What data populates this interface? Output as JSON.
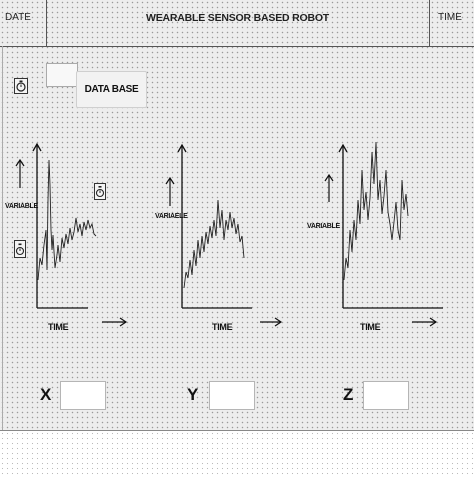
{
  "header": {
    "date_label": "DATE",
    "title": "WEARABLE SENSOR BASED ROBOT",
    "time_label": "TIME"
  },
  "toolbar": {
    "database_label": "DATA BASE"
  },
  "plots": [
    {
      "id": "x",
      "ylabel": "VARIABLE",
      "xlabel": "TIME"
    },
    {
      "id": "y",
      "ylabel": "VARIAELE",
      "xlabel": "TIME"
    },
    {
      "id": "z",
      "ylabel": "VARIABLE",
      "xlabel": "TIME"
    }
  ],
  "readouts": {
    "x_label": "X",
    "y_label": "Y",
    "z_label": "Z",
    "x_value": "",
    "y_value": "",
    "z_value": ""
  },
  "icons": {
    "top": "stopwatch-icon",
    "left": "stopwatch-icon",
    "mid": "stopwatch-icon"
  },
  "colors": {
    "background": "#ededed",
    "trace": "#222222",
    "axis": "#111111"
  }
}
